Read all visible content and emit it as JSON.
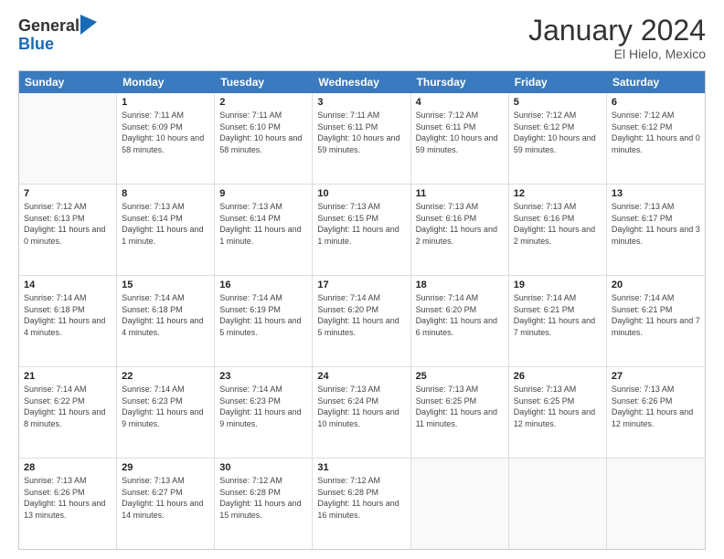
{
  "header": {
    "logo_general": "General",
    "logo_blue": "Blue",
    "month_title": "January 2024",
    "location": "El Hielo, Mexico"
  },
  "days_of_week": [
    "Sunday",
    "Monday",
    "Tuesday",
    "Wednesday",
    "Thursday",
    "Friday",
    "Saturday"
  ],
  "weeks": [
    [
      {
        "day": "",
        "sunrise": "",
        "sunset": "",
        "daylight": "",
        "empty": true
      },
      {
        "day": "1",
        "sunrise": "Sunrise: 7:11 AM",
        "sunset": "Sunset: 6:09 PM",
        "daylight": "Daylight: 10 hours and 58 minutes."
      },
      {
        "day": "2",
        "sunrise": "Sunrise: 7:11 AM",
        "sunset": "Sunset: 6:10 PM",
        "daylight": "Daylight: 10 hours and 58 minutes."
      },
      {
        "day": "3",
        "sunrise": "Sunrise: 7:11 AM",
        "sunset": "Sunset: 6:11 PM",
        "daylight": "Daylight: 10 hours and 59 minutes."
      },
      {
        "day": "4",
        "sunrise": "Sunrise: 7:12 AM",
        "sunset": "Sunset: 6:11 PM",
        "daylight": "Daylight: 10 hours and 59 minutes."
      },
      {
        "day": "5",
        "sunrise": "Sunrise: 7:12 AM",
        "sunset": "Sunset: 6:12 PM",
        "daylight": "Daylight: 10 hours and 59 minutes."
      },
      {
        "day": "6",
        "sunrise": "Sunrise: 7:12 AM",
        "sunset": "Sunset: 6:12 PM",
        "daylight": "Daylight: 11 hours and 0 minutes."
      }
    ],
    [
      {
        "day": "7",
        "sunrise": "Sunrise: 7:12 AM",
        "sunset": "Sunset: 6:13 PM",
        "daylight": "Daylight: 11 hours and 0 minutes."
      },
      {
        "day": "8",
        "sunrise": "Sunrise: 7:13 AM",
        "sunset": "Sunset: 6:14 PM",
        "daylight": "Daylight: 11 hours and 1 minute."
      },
      {
        "day": "9",
        "sunrise": "Sunrise: 7:13 AM",
        "sunset": "Sunset: 6:14 PM",
        "daylight": "Daylight: 11 hours and 1 minute."
      },
      {
        "day": "10",
        "sunrise": "Sunrise: 7:13 AM",
        "sunset": "Sunset: 6:15 PM",
        "daylight": "Daylight: 11 hours and 1 minute."
      },
      {
        "day": "11",
        "sunrise": "Sunrise: 7:13 AM",
        "sunset": "Sunset: 6:16 PM",
        "daylight": "Daylight: 11 hours and 2 minutes."
      },
      {
        "day": "12",
        "sunrise": "Sunrise: 7:13 AM",
        "sunset": "Sunset: 6:16 PM",
        "daylight": "Daylight: 11 hours and 2 minutes."
      },
      {
        "day": "13",
        "sunrise": "Sunrise: 7:13 AM",
        "sunset": "Sunset: 6:17 PM",
        "daylight": "Daylight: 11 hours and 3 minutes."
      }
    ],
    [
      {
        "day": "14",
        "sunrise": "Sunrise: 7:14 AM",
        "sunset": "Sunset: 6:18 PM",
        "daylight": "Daylight: 11 hours and 4 minutes."
      },
      {
        "day": "15",
        "sunrise": "Sunrise: 7:14 AM",
        "sunset": "Sunset: 6:18 PM",
        "daylight": "Daylight: 11 hours and 4 minutes."
      },
      {
        "day": "16",
        "sunrise": "Sunrise: 7:14 AM",
        "sunset": "Sunset: 6:19 PM",
        "daylight": "Daylight: 11 hours and 5 minutes."
      },
      {
        "day": "17",
        "sunrise": "Sunrise: 7:14 AM",
        "sunset": "Sunset: 6:20 PM",
        "daylight": "Daylight: 11 hours and 5 minutes."
      },
      {
        "day": "18",
        "sunrise": "Sunrise: 7:14 AM",
        "sunset": "Sunset: 6:20 PM",
        "daylight": "Daylight: 11 hours and 6 minutes."
      },
      {
        "day": "19",
        "sunrise": "Sunrise: 7:14 AM",
        "sunset": "Sunset: 6:21 PM",
        "daylight": "Daylight: 11 hours and 7 minutes."
      },
      {
        "day": "20",
        "sunrise": "Sunrise: 7:14 AM",
        "sunset": "Sunset: 6:21 PM",
        "daylight": "Daylight: 11 hours and 7 minutes."
      }
    ],
    [
      {
        "day": "21",
        "sunrise": "Sunrise: 7:14 AM",
        "sunset": "Sunset: 6:22 PM",
        "daylight": "Daylight: 11 hours and 8 minutes."
      },
      {
        "day": "22",
        "sunrise": "Sunrise: 7:14 AM",
        "sunset": "Sunset: 6:23 PM",
        "daylight": "Daylight: 11 hours and 9 minutes."
      },
      {
        "day": "23",
        "sunrise": "Sunrise: 7:14 AM",
        "sunset": "Sunset: 6:23 PM",
        "daylight": "Daylight: 11 hours and 9 minutes."
      },
      {
        "day": "24",
        "sunrise": "Sunrise: 7:13 AM",
        "sunset": "Sunset: 6:24 PM",
        "daylight": "Daylight: 11 hours and 10 minutes."
      },
      {
        "day": "25",
        "sunrise": "Sunrise: 7:13 AM",
        "sunset": "Sunset: 6:25 PM",
        "daylight": "Daylight: 11 hours and 11 minutes."
      },
      {
        "day": "26",
        "sunrise": "Sunrise: 7:13 AM",
        "sunset": "Sunset: 6:25 PM",
        "daylight": "Daylight: 11 hours and 12 minutes."
      },
      {
        "day": "27",
        "sunrise": "Sunrise: 7:13 AM",
        "sunset": "Sunset: 6:26 PM",
        "daylight": "Daylight: 11 hours and 12 minutes."
      }
    ],
    [
      {
        "day": "28",
        "sunrise": "Sunrise: 7:13 AM",
        "sunset": "Sunset: 6:26 PM",
        "daylight": "Daylight: 11 hours and 13 minutes."
      },
      {
        "day": "29",
        "sunrise": "Sunrise: 7:13 AM",
        "sunset": "Sunset: 6:27 PM",
        "daylight": "Daylight: 11 hours and 14 minutes."
      },
      {
        "day": "30",
        "sunrise": "Sunrise: 7:12 AM",
        "sunset": "Sunset: 6:28 PM",
        "daylight": "Daylight: 11 hours and 15 minutes."
      },
      {
        "day": "31",
        "sunrise": "Sunrise: 7:12 AM",
        "sunset": "Sunset: 6:28 PM",
        "daylight": "Daylight: 11 hours and 16 minutes."
      },
      {
        "day": "",
        "sunrise": "",
        "sunset": "",
        "daylight": "",
        "empty": true
      },
      {
        "day": "",
        "sunrise": "",
        "sunset": "",
        "daylight": "",
        "empty": true
      },
      {
        "day": "",
        "sunrise": "",
        "sunset": "",
        "daylight": "",
        "empty": true
      }
    ]
  ]
}
